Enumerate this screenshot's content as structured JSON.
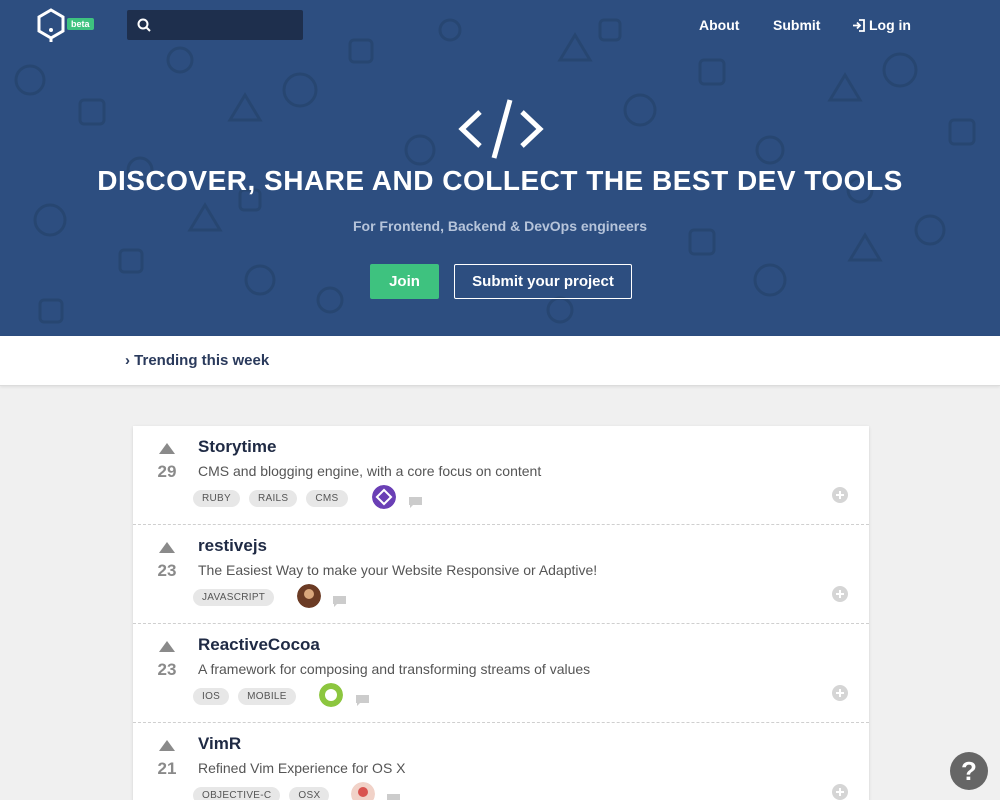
{
  "nav": {
    "beta_label": "beta",
    "about_label": "About",
    "submit_label": "Submit",
    "login_label": "Log in"
  },
  "hero": {
    "title": "DISCOVER, SHARE AND COLLECT THE BEST DEV TOOLS",
    "subtitle": "For Frontend, Backend & DevOps engineers",
    "join_label": "Join",
    "submit_project_label": "Submit your project"
  },
  "trending": {
    "label": "Trending this week"
  },
  "items": [
    {
      "name": "Storytime",
      "votes": "29",
      "description": "CMS and blogging engine, with a core focus on content",
      "tags": [
        "RUBY",
        "RAILS",
        "CMS"
      ],
      "avatar_color": "#6a3fb5"
    },
    {
      "name": "restivejs",
      "votes": "23",
      "description": "The Easiest Way to make your Website Responsive or Adaptive!",
      "tags": [
        "JAVASCRIPT"
      ],
      "avatar_color": "#6b3b24"
    },
    {
      "name": "ReactiveCocoa",
      "votes": "23",
      "description": "A framework for composing and transforming streams of values",
      "tags": [
        "IOS",
        "MOBILE"
      ],
      "avatar_color": "#8cc63f"
    },
    {
      "name": "VimR",
      "votes": "21",
      "description": "Refined Vim Experience for OS X",
      "tags": [
        "OBJECTIVE-C",
        "OSX"
      ],
      "avatar_color": "#d9534f"
    }
  ],
  "help": {
    "label": "?"
  },
  "colors": {
    "hero_bg": "#2d4e80",
    "accent_green": "#3ec27f",
    "title_dark": "#1f2a44"
  }
}
